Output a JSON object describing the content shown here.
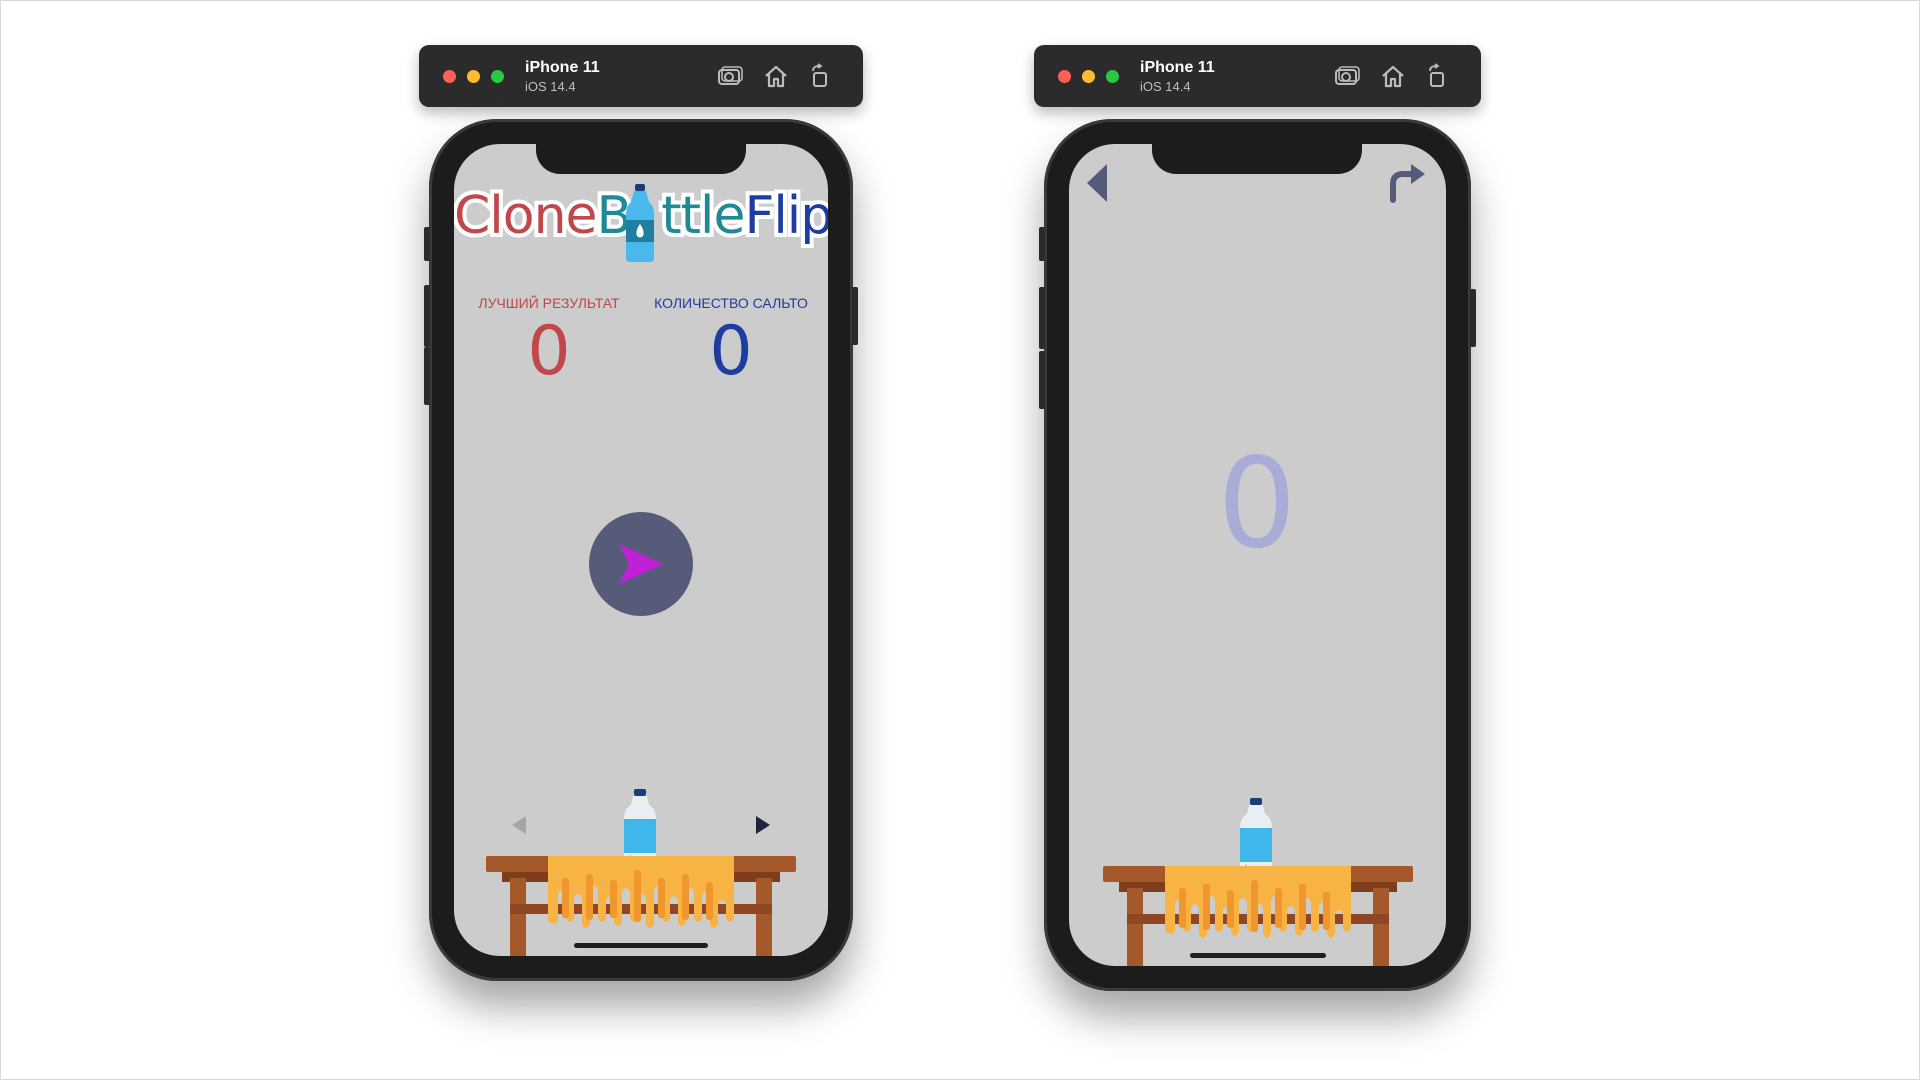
{
  "simulators": [
    {
      "device": "iPhone 11",
      "os": "iOS 14.4",
      "toolbar": [
        "screenshot-icon",
        "home-icon",
        "rotate-icon"
      ]
    },
    {
      "device": "iPhone 11",
      "os": "iOS 14.4",
      "toolbar": [
        "screenshot-icon",
        "home-icon",
        "rotate-icon"
      ]
    }
  ],
  "menu_screen": {
    "logo": {
      "part1": "Clone",
      "part2": "B",
      "part3": "ttle",
      "part4": "Flip"
    },
    "best_result": {
      "label": "ЛУЧШИЙ РЕЗУЛЬТАТ",
      "value": "0"
    },
    "flip_count": {
      "label": "КОЛИЧЕСТВО САЛЬТО",
      "value": "0"
    },
    "play_icon": "play-arrow-icon",
    "prev_icon": "triangle-left-icon",
    "next_icon": "triangle-right-icon"
  },
  "game_screen": {
    "back_icon": "triangle-left-icon",
    "restart_icon": "redo-arrow-icon",
    "score": "0"
  },
  "colors": {
    "screen_bg": "#cccccc",
    "best_red": "#c0474a",
    "count_blue": "#1e3da0",
    "play_circle": "#555b78",
    "play_arrow": "#c21fd8",
    "game_score": "#a9acd6",
    "table_wood": "#a5582a",
    "tablecloth": "#f7b444",
    "bottle_blue": "#3fb7ea"
  }
}
